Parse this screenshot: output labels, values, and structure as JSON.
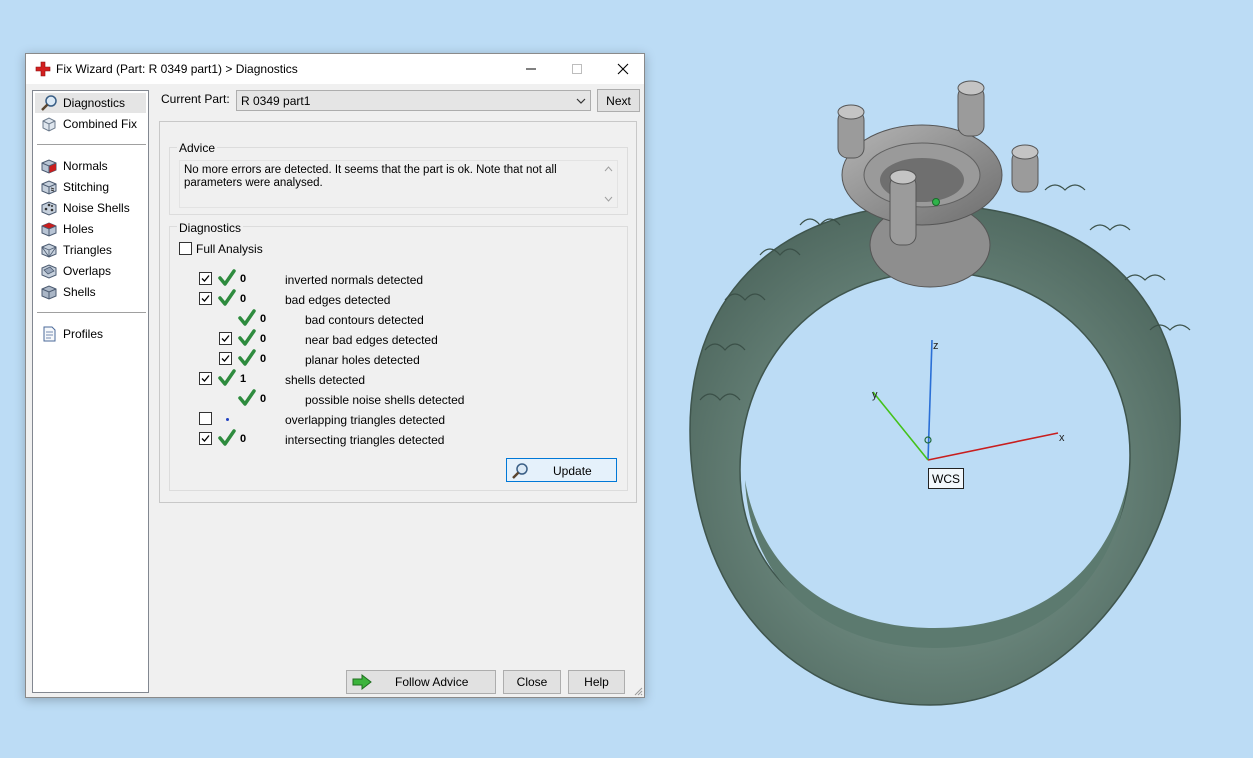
{
  "window": {
    "title": "Fix Wizard (Part: R 0349 part1) > Diagnostics"
  },
  "sidebar": {
    "items": [
      {
        "label": "Diagnostics",
        "icon": "magnifier-icon",
        "selected": true
      },
      {
        "label": "Combined Fix",
        "icon": "combined-fix-icon"
      },
      {
        "label": "Normals",
        "icon": "normals-cube-icon"
      },
      {
        "label": "Stitching",
        "icon": "stitching-icon"
      },
      {
        "label": "Noise Shells",
        "icon": "noise-shells-icon"
      },
      {
        "label": "Holes",
        "icon": "holes-cube-icon"
      },
      {
        "label": "Triangles",
        "icon": "triangles-cube-icon"
      },
      {
        "label": "Overlaps",
        "icon": "overlaps-icon"
      },
      {
        "label": "Shells",
        "icon": "shells-icon"
      },
      {
        "label": "Profiles",
        "icon": "profiles-document-icon"
      }
    ]
  },
  "current_part": {
    "label": "Current Part:",
    "value": "R 0349 part1",
    "next_label": "Next"
  },
  "advice": {
    "title": "Advice",
    "text": "No more errors are detected. It seems that the part is ok. Note that not all parameters were analysed."
  },
  "diagnostics": {
    "title": "Diagnostics",
    "full_analysis_label": "Full Analysis",
    "full_analysis_checked": false,
    "rows": [
      {
        "checkbox": true,
        "checked": true,
        "status": "ok",
        "count": "0",
        "label": "inverted normals detected"
      },
      {
        "checkbox": true,
        "checked": true,
        "status": "ok",
        "count": "0",
        "label": "bad edges detected"
      },
      {
        "checkbox": false,
        "checked": false,
        "status": "ok",
        "count": "0",
        "label": "bad contours detected"
      },
      {
        "checkbox": true,
        "checked": true,
        "status": "ok",
        "count": "0",
        "label": "near bad edges detected"
      },
      {
        "checkbox": true,
        "checked": true,
        "status": "ok",
        "count": "0",
        "label": "planar holes detected"
      },
      {
        "checkbox": true,
        "checked": true,
        "status": "ok",
        "count": "1",
        "label": "shells detected"
      },
      {
        "checkbox": false,
        "checked": false,
        "status": "ok",
        "count": "0",
        "label": "possible noise shells detected"
      },
      {
        "checkbox": true,
        "checked": false,
        "status": "none",
        "count": "",
        "label": "overlapping triangles detected"
      },
      {
        "checkbox": true,
        "checked": true,
        "status": "ok",
        "count": "0",
        "label": "intersecting triangles detected"
      }
    ],
    "update_label": "Update"
  },
  "footer": {
    "follow_advice_label": "Follow Advice",
    "close_label": "Close",
    "help_label": "Help"
  },
  "viewport": {
    "wcs_label": "WCS",
    "axis_x": "x",
    "axis_y": "y",
    "axis_z": "z"
  },
  "colors": {
    "background": "#bcdcf5",
    "check_green": "#2e8b3e",
    "ring_green": "#6f8f84",
    "setting_gray": "#8e8e8e",
    "button_focus": "#0078d7"
  }
}
